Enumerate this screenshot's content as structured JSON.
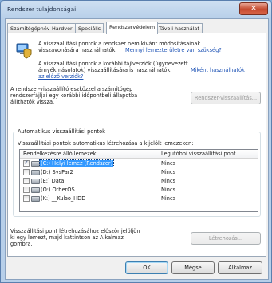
{
  "window": {
    "title": "Rendszer tulajdonságai",
    "close_label": "✕"
  },
  "tabs": [
    {
      "label": "Számítógépnév"
    },
    {
      "label": "Hardver"
    },
    {
      "label": "Speciális"
    },
    {
      "label": "Rendszervédelem"
    },
    {
      "label": "Távoli használat"
    }
  ],
  "intro": {
    "line1": "A visszaállítási pontok a rendszer nem kívánt módosításainak",
    "line2_text": "visszavonására használhatók.",
    "line2_link": "Mennyi lemezterületre van szükség?",
    "p2_line1": "A visszaállítási pontok a korábbi fájlverziók (úgynevezett",
    "p2_line2_text": "árnyékmásolatok) visszaállítására is használhatók.",
    "p2_line2_link": "Miként használhatók",
    "p2_line3_link": "az előző verziók?"
  },
  "restore": {
    "line1": "A rendszer-visszaállító eszközzel a számítógép",
    "line2": "rendszerfájljai egy korábbi időpontbeli állapotba",
    "line3": "állíthatók vissza.",
    "button": "Rendszer-visszaállítás..."
  },
  "auto_group": {
    "title": "Automatikus visszaállítási pontok",
    "description": "Visszaállítási pontok automatikus létrehozása a kijelölt lemezeken:",
    "col_disks": "Rendelkezésre álló lemezek",
    "col_last": "Legutóbbi visszaállítási pont",
    "rows": [
      {
        "name": "(C:) Helyi lemez (Rendszer)",
        "status": "Nincs",
        "checked": true
      },
      {
        "name": "(D:) SysPar2",
        "status": "Nincs",
        "checked": false
      },
      {
        "name": "(E:) Data",
        "status": "Nincs",
        "checked": false
      },
      {
        "name": "(O:) OtherOS",
        "status": "Nincs",
        "checked": false
      },
      {
        "name": "(K:) __Kulso_HDD",
        "status": "Nincs",
        "checked": false
      }
    ]
  },
  "create": {
    "line1": "Visszaállítási pont létrehozásához először jelöljön",
    "line2": "ki egy lemezt, majd kattintson az Alkalmaz",
    "line3": "gombra.",
    "button": "Létrehozás..."
  },
  "footer": {
    "ok": "OK",
    "cancel": "Mégse",
    "apply": "Alkalmaz"
  }
}
